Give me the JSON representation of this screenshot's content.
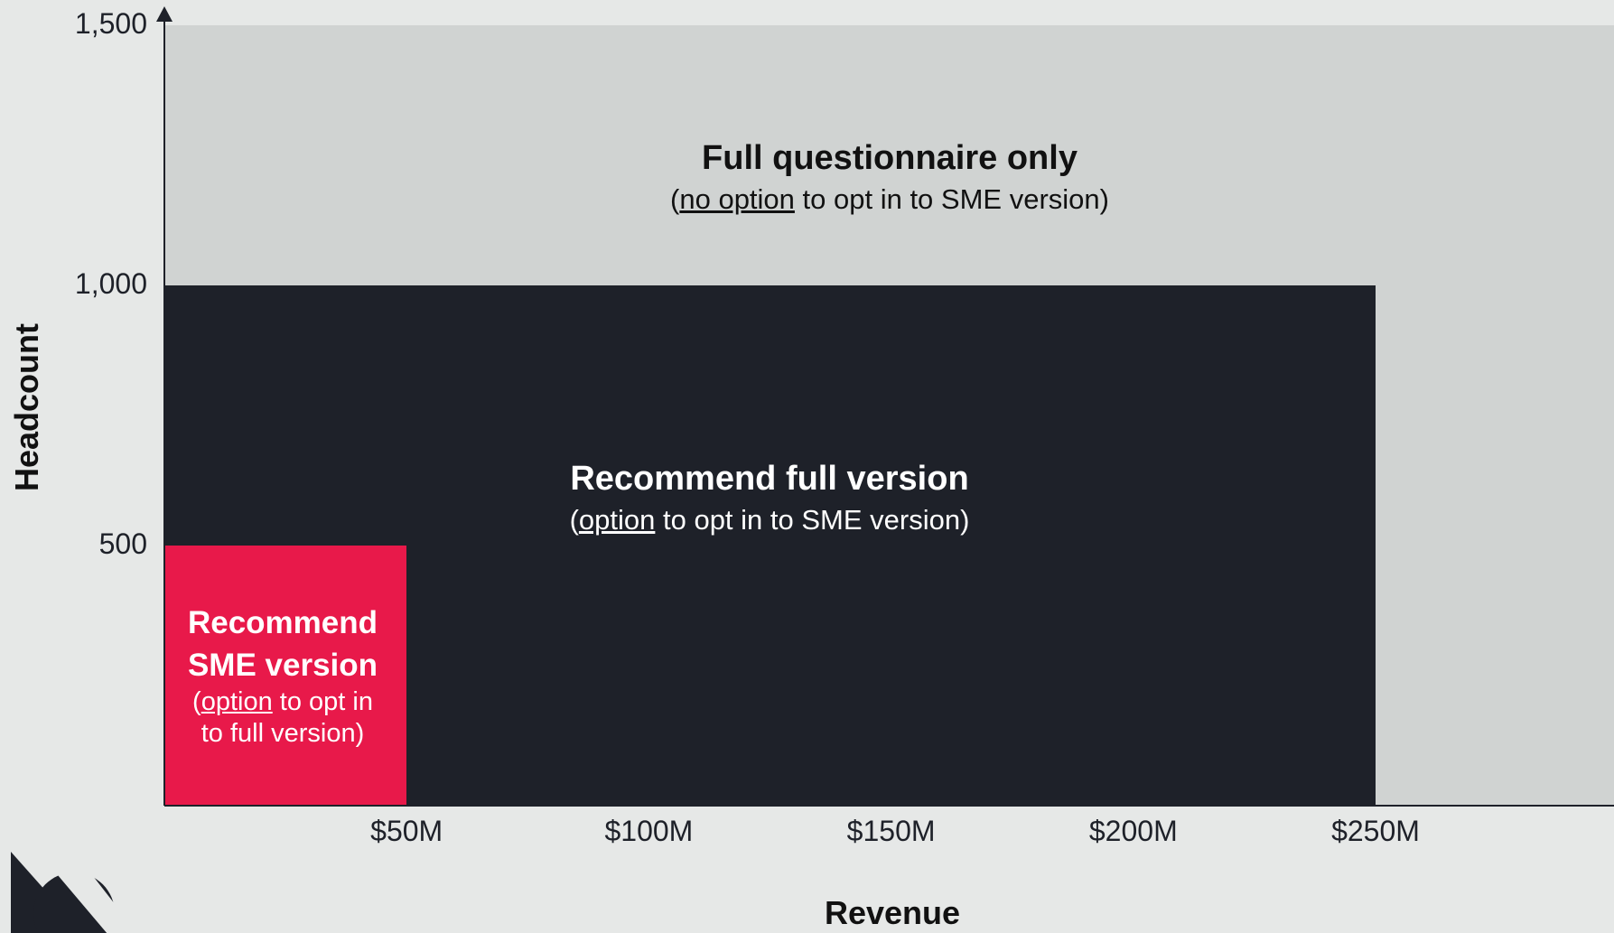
{
  "chart_data": {
    "type": "heatmap",
    "xlabel": "Revenue",
    "ylabel": "Headcount",
    "xlim": [
      0,
      300
    ],
    "ylim": [
      0,
      1500
    ],
    "x_unit": "$M",
    "x_ticks": [
      {
        "value": 50,
        "label": "$50M"
      },
      {
        "value": 100,
        "label": "$100M"
      },
      {
        "value": 150,
        "label": "$150M"
      },
      {
        "value": 200,
        "label": "$200M"
      },
      {
        "value": 250,
        "label": "$250M"
      }
    ],
    "y_ticks": [
      {
        "value": 500,
        "label": "500"
      },
      {
        "value": 1000,
        "label": "1,000"
      },
      {
        "value": 1500,
        "label": "1,500"
      }
    ],
    "regions": [
      {
        "id": "full-only",
        "title": "Full questionnaire only",
        "subtitle_pre": "(",
        "subtitle_link": "no option",
        "subtitle_post": " to opt in to SME version)",
        "x_range": [
          0,
          300
        ],
        "y_range": [
          0,
          1500
        ],
        "fill": "#d0d3d2",
        "text_color": "#111111"
      },
      {
        "id": "recommend-full",
        "title": "Recommend full version",
        "subtitle_pre": "(",
        "subtitle_link": "option",
        "subtitle_post": " to opt in to SME version)",
        "x_range": [
          0,
          250
        ],
        "y_range": [
          0,
          1000
        ],
        "fill": "#1e2129",
        "text_color": "#ffffff"
      },
      {
        "id": "recommend-sme",
        "title_lines": [
          "Recommend",
          "SME version"
        ],
        "subtitle_pre": "(",
        "subtitle_link": "option",
        "subtitle_post": " to opt in",
        "subtitle_line2": "to full version)",
        "x_range": [
          0,
          50
        ],
        "y_range": [
          0,
          500
        ],
        "fill": "#e8194a",
        "text_color": "#ffffff"
      }
    ]
  },
  "colors": {
    "background": "#e6e8e7",
    "axis": "#1e2129",
    "logo": "#1e2129"
  },
  "logo": {
    "icon": "brand-logo-icon"
  }
}
